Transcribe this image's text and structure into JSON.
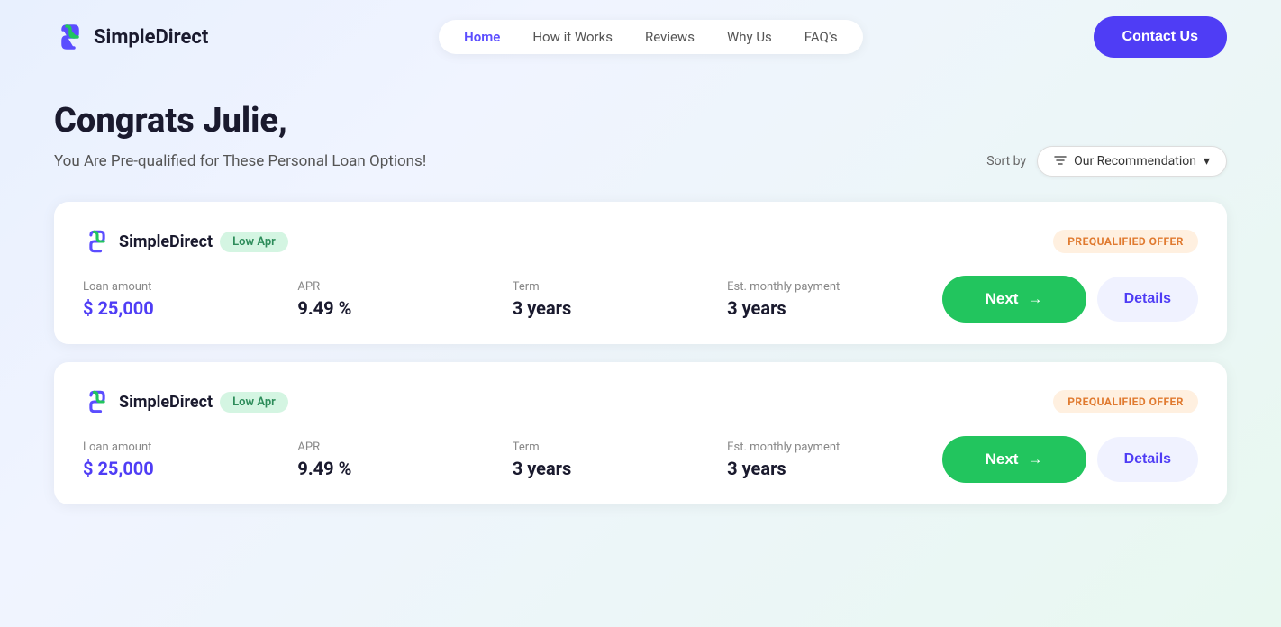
{
  "header": {
    "logo_text": "SimpleDirect",
    "nav": {
      "items": [
        {
          "label": "Home",
          "active": true
        },
        {
          "label": "How it Works",
          "active": false
        },
        {
          "label": "Reviews",
          "active": false
        },
        {
          "label": "Why Us",
          "active": false
        },
        {
          "label": "FAQ's",
          "active": false
        }
      ]
    },
    "contact_label": "Contact Us"
  },
  "main": {
    "page_title": "Congrats Julie,",
    "subtitle": "You Are Pre-qualified for These Personal Loan Options!",
    "sort_label": "Sort by",
    "sort_value": "Our Recommendation",
    "cards": [
      {
        "logo_text": "SimpleDirect",
        "badge_low_apr": "Low Apr",
        "badge_prequalified": "PREQUALIFIED OFFER",
        "loan_amount_label": "Loan amount",
        "loan_amount_value": "$ 25,000",
        "apr_label": "APR",
        "apr_value": "9.49 %",
        "term_label": "Term",
        "term_value": "3 years",
        "monthly_label": "Est. monthly payment",
        "monthly_value": "3 years",
        "next_label": "Next",
        "details_label": "Details"
      },
      {
        "logo_text": "SimpleDirect",
        "badge_low_apr": "Low Apr",
        "badge_prequalified": "PREQUALIFIED OFFER",
        "loan_amount_label": "Loan amount",
        "loan_amount_value": "$ 25,000",
        "apr_label": "APR",
        "apr_value": "9.49 %",
        "term_label": "Term",
        "term_value": "3 years",
        "monthly_label": "Est. monthly payment",
        "monthly_value": "3 years",
        "next_label": "Next",
        "details_label": "Details"
      }
    ]
  }
}
